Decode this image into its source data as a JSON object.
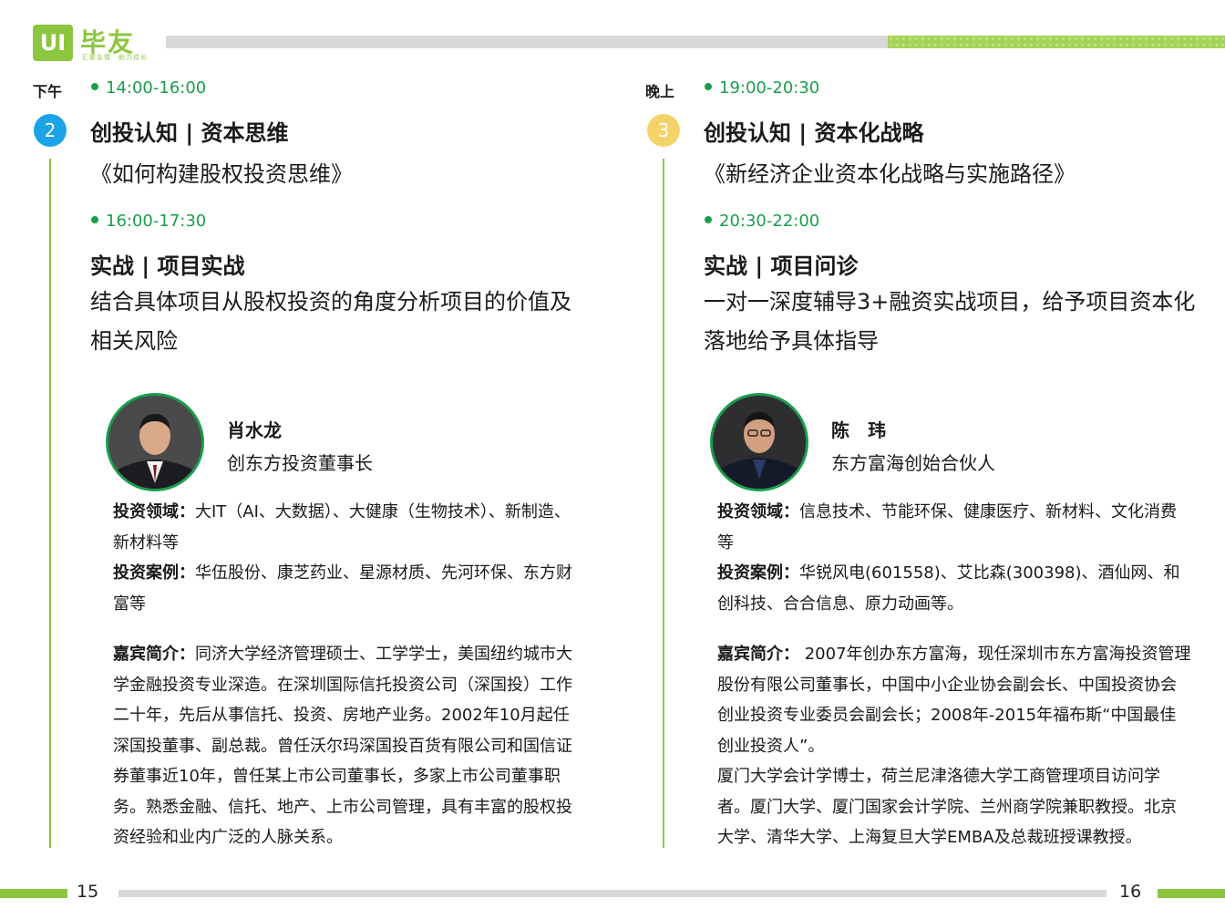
{
  "header": {
    "logo_mark": "UI",
    "logo_name": "毕友",
    "logo_tagline": "汇聚友情　助力成长"
  },
  "footer": {
    "left_page": "15",
    "right_page": "16"
  },
  "left": {
    "period": "下午",
    "badge": "2",
    "badge_color": "#1aa3e8",
    "session1": {
      "time": "14:00-16:00",
      "title": "创投认知 | 资本思维",
      "subtitle": "《如何构建股权投资思维》"
    },
    "session2": {
      "time": "16:00-17:30",
      "title": "实战 | 项目实战",
      "desc_line1": "结合具体项目从股权投资的角度分析项目的价值及",
      "desc_line2": "相关风险"
    },
    "speaker": {
      "name": "肖水龙",
      "role": "创东方投资董事长",
      "field_label": "投资领域：",
      "field_text": "大IT（AI、大数据）、大健康（生物技术）、新制造、新材料等",
      "case_label": "投资案例：",
      "case_text": "华伍股份、康芝药业、星源材质、先河环保、东方财富等",
      "bio_label": "嘉宾简介：",
      "bio_text": "同济大学经济管理硕士、工学学士，美国纽约城市大学金融投资专业深造。在深圳国际信托投资公司（深国投）工作二十年，先后从事信托、投资、房地产业务。2002年10月起任深国投董事、副总裁。曾任沃尔玛深国投百货有限公司和国信证券董事近10年，曾任某上市公司董事长，多家上市公司董事职务。熟悉金融、信托、地产、上市公司管理，具有丰富的股权投资经验和业内广泛的人脉关系。"
    }
  },
  "right": {
    "period": "晚上",
    "badge": "3",
    "badge_color": "#f5d36b",
    "session1": {
      "time": "19:00-20:30",
      "title": "创投认知 | 资本化战略",
      "subtitle": "《新经济企业资本化战略与实施路径》"
    },
    "session2": {
      "time": "20:30-22:00",
      "title": "实战 | 项目问诊",
      "desc_line1": "一对一深度辅导3+融资实战项目，给予项目资本化",
      "desc_line2": "落地给予具体指导"
    },
    "speaker": {
      "name": "陈　玮",
      "role": "东方富海创始合伙人",
      "field_label": "投资领域：",
      "field_text": "信息技术、节能环保、健康医疗、新材料、文化消费等",
      "case_label": "投资案例：",
      "case_text": "华锐风电(601558)、艾比森(300398)、酒仙网、和创科技、合合信息、原力动画等。",
      "bio_label": "嘉宾简介：",
      "bio_text1": " 2007年创办东方富海，现任深圳市东方富海投资管理股份有限公司董事长，中国中小企业协会副会长、中国投资协会创业投资专业委员会副会长；2008年-2015年福布斯“中国最佳创业投资人”。",
      "bio_text2": "厦门大学会计学博士，荷兰尼津洛德大学工商管理项目访问学者。厦门大学、厦门国家会计学院、兰州商学院兼职教授。北京大学、清华大学、上海复旦大学EMBA及总裁班授课教授。"
    }
  }
}
